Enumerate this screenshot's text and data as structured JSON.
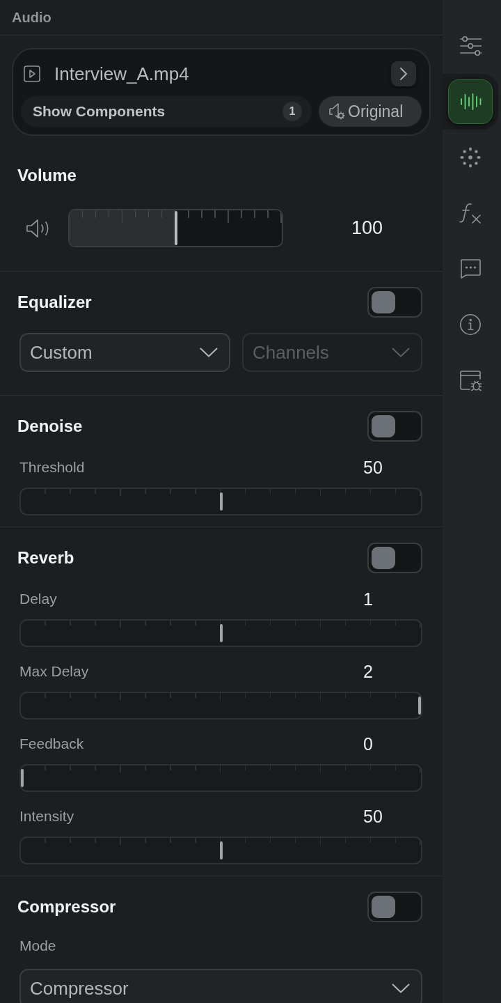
{
  "panel": {
    "title": "Audio"
  },
  "media": {
    "title": "Interview_A.mp4",
    "components_label": "Show Components",
    "components_count": "1",
    "original_label": "Original"
  },
  "sections": [
    {
      "kind": "volume",
      "title": "Volume",
      "level": 0.5,
      "reading": "100"
    },
    {
      "kind": "dropdowns",
      "title": "Equalizer",
      "on": false,
      "dropdowns": [
        {
          "value": "Custom",
          "disabled": false
        },
        {
          "value": "Channels",
          "disabled": true
        }
      ]
    },
    {
      "kind": "sliders",
      "title": "Denoise",
      "on": false,
      "sliders": [
        {
          "label": "Threshold",
          "reading": "50",
          "level": 0.5
        }
      ]
    },
    {
      "kind": "sliders",
      "title": "Reverb",
      "on": false,
      "sliders": [
        {
          "label": "Delay",
          "reading": "1",
          "level": 0.5
        },
        {
          "label": "Max Delay",
          "reading": "2",
          "level": 1
        },
        {
          "label": "Feedback",
          "reading": "0",
          "level": 0
        },
        {
          "label": "Intensity",
          "reading": "50",
          "level": 0.5
        }
      ]
    },
    {
      "kind": "select",
      "title": "Compressor",
      "on": false,
      "field_label": "Mode",
      "dropdown": {
        "value": "Compressor",
        "disabled": false
      }
    }
  ],
  "sidebar": {
    "items": [
      {
        "selected": false
      },
      {
        "selected": true
      },
      {
        "selected": false
      },
      {
        "selected": false
      },
      {
        "selected": false
      },
      {
        "selected": false
      },
      {
        "selected": false
      }
    ]
  }
}
